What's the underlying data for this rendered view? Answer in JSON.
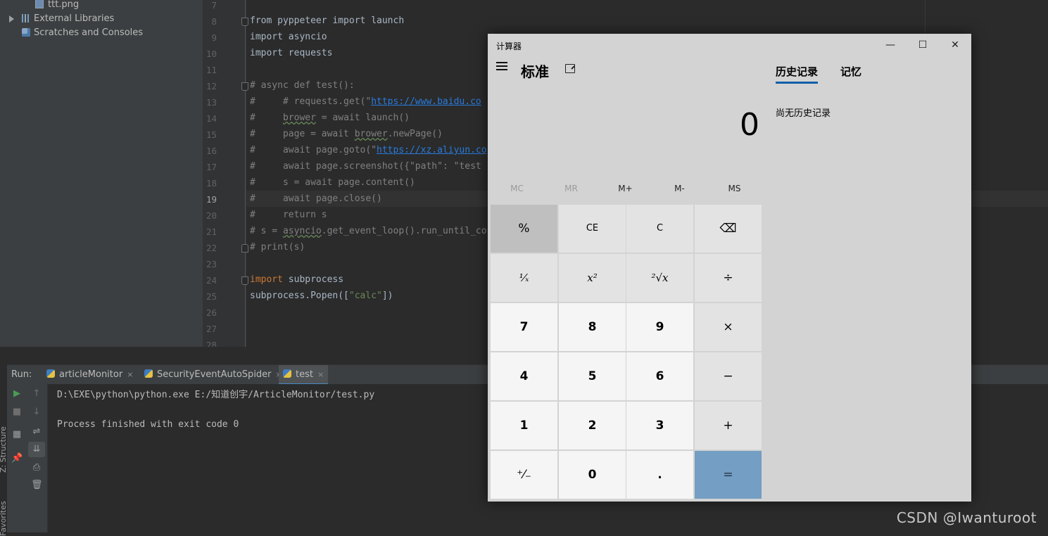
{
  "project": {
    "items": [
      {
        "label": "ttt.png",
        "icon": "image-file-icon"
      },
      {
        "label": "External Libraries",
        "icon": "library-icon"
      },
      {
        "label": "Scratches and Consoles",
        "icon": "scratch-icon"
      }
    ]
  },
  "editor": {
    "line_numbers": [
      "7",
      "8",
      "9",
      "10",
      "11",
      "12",
      "13",
      "14",
      "15",
      "16",
      "17",
      "18",
      "19",
      "20",
      "21",
      "22",
      "23",
      "24",
      "25",
      "26",
      "27",
      "28"
    ],
    "current_line": "19",
    "lines": {
      "l8": {
        "kw1": "from",
        "t1": " pyppeteer ",
        "kw2": "import",
        "t2": " launch"
      },
      "l9": {
        "kw1": "import",
        "t1": " asyncio"
      },
      "l10": {
        "kw1": "import",
        "t1": " requests"
      },
      "l12": "# async def test():",
      "l13_a": "#     # requests.get(\"",
      "l13_url": "https://www.baidu.co",
      "l14_a": "#     ",
      "l14_w": "brower",
      "l14_b": " = await launch()",
      "l15_a": "#     page = await ",
      "l15_w": "brower",
      "l15_b": ".newPage()",
      "l16_a": "#     await page.goto(\"",
      "l16_url": "https://xz.aliyun.co",
      "l17": "#     await page.screenshot({\"path\": \"test",
      "l18": "#     s = await page.content()",
      "l19": "#     await page.close()",
      "l20": "#     return s",
      "l21_a": "# s = ",
      "l21_w": "asyncio",
      "l21_b": ".get_event_loop().run_until_co",
      "l22": "# print(s)",
      "l24": {
        "kw1": "import",
        "t1": " subprocess"
      },
      "l25": {
        "t1": "subprocess.Popen([",
        "s1": "\"calc\"",
        "t2": "])"
      }
    }
  },
  "run": {
    "label": "Run:",
    "tabs": [
      {
        "label": "articleMonitor",
        "close": "×"
      },
      {
        "label": "SecurityEventAutoSpider",
        "close": "×"
      },
      {
        "label": "test",
        "close": "×"
      }
    ],
    "console": [
      "D:\\EXE\\python\\python.exe E:/知道创宇/ArticleMonitor/test.py",
      "",
      "Process finished with exit code 0"
    ],
    "side_labels": {
      "structure": "Z: Structure",
      "favorites": "Favorites"
    }
  },
  "calculator": {
    "title": "计算器",
    "mode": "标准",
    "display": "0",
    "window_buttons": {
      "minimize": "—",
      "maximize": "☐",
      "close": "✕"
    },
    "memory": [
      "MC",
      "MR",
      "M+",
      "M-",
      "MS"
    ],
    "keys": [
      [
        "%",
        "CE",
        "C",
        "⌫"
      ],
      [
        "¹⁄ₓ",
        "x²",
        "²√x",
        "÷"
      ],
      [
        "7",
        "8",
        "9",
        "×"
      ],
      [
        "4",
        "5",
        "6",
        "−"
      ],
      [
        "1",
        "2",
        "3",
        "+"
      ],
      [
        "⁺⁄₋",
        "0",
        ".",
        "="
      ]
    ],
    "history_tab": "历史记录",
    "memory_tab": "记忆",
    "history_empty": "尚无历史记录"
  },
  "watermark": "CSDN @Iwanturoot"
}
